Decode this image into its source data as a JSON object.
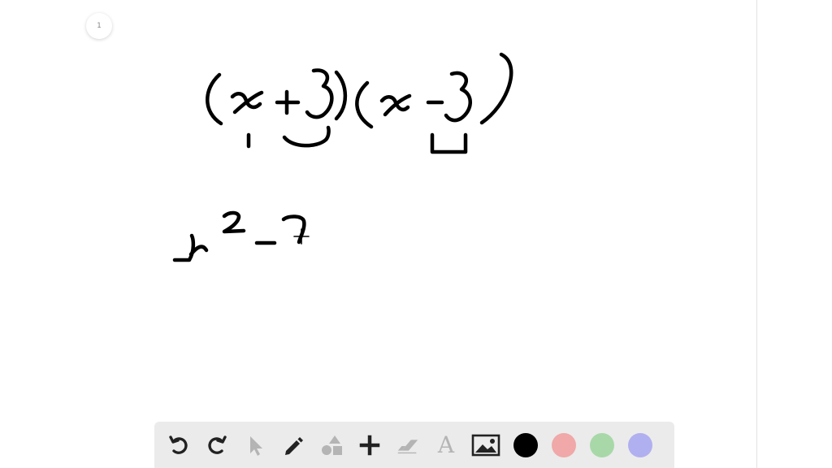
{
  "page": {
    "number": "1"
  },
  "toolbar": {
    "tools": [
      {
        "name": "undo-icon",
        "label": ""
      },
      {
        "name": "redo-icon",
        "label": ""
      },
      {
        "name": "select-arrow-icon",
        "label": ""
      },
      {
        "name": "pencil-icon",
        "label": ""
      },
      {
        "name": "shapes-icon",
        "label": ""
      },
      {
        "name": "plus-icon",
        "label": ""
      },
      {
        "name": "eraser-icon",
        "label": ""
      },
      {
        "name": "text-tool-icon",
        "label": "A"
      },
      {
        "name": "image-icon",
        "label": ""
      }
    ],
    "text_tool_glyph": "A",
    "colors": {
      "black": "#000000",
      "red": "#f0a8a8",
      "green": "#a8d8a8",
      "blue": "#b0b0f0"
    },
    "selected_color": "black"
  },
  "theme": {
    "toolbar_bg": "#ebebeb",
    "icon_dark": "#222222",
    "icon_disabled": "#b4b4b4",
    "ink": "#000000"
  }
}
